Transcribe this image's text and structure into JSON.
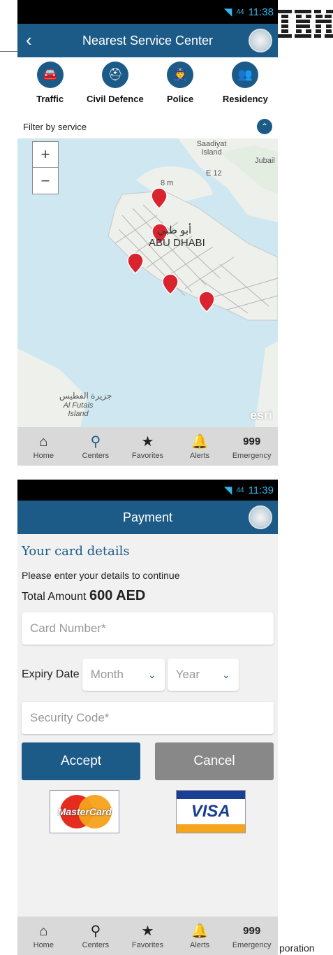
{
  "screen1": {
    "status": {
      "signal_small": "44",
      "time": "11:38"
    },
    "appbar_title": "Nearest Service Center",
    "services": [
      {
        "label": "Traffic",
        "icon": "car-icon"
      },
      {
        "label": "Civil Defence",
        "icon": "firefighter-icon"
      },
      {
        "label": "Police",
        "icon": "police-officer-icon"
      },
      {
        "label": "Residency",
        "icon": "residency-icon"
      }
    ],
    "filter_label": "Filter by service",
    "map": {
      "zoom_in": "+",
      "zoom_out": "−",
      "labels": {
        "saadiyat": "Saadiyat Island",
        "jubail": "Jubail",
        "e12": "E 12",
        "distance": "8 m",
        "city_ar": "أبو ظبي",
        "city_en": "ABU DHABI",
        "futais_ar": "جزيرة الفطيس",
        "futais_en": "Al Futais Island"
      },
      "attribution": "esri"
    }
  },
  "screen2": {
    "status": {
      "signal_small": "44",
      "time": "11:39"
    },
    "appbar_title": "Payment",
    "heading": "Your card details",
    "instructions": "Please enter your details to continue",
    "total_label": "Total Amount",
    "total_value": "600 AED",
    "card_number_placeholder": "Card Number*",
    "expiry_label": "Expiry Date",
    "month_placeholder": "Month",
    "year_placeholder": "Year",
    "security_placeholder": "Security Code*",
    "accept_label": "Accept",
    "cancel_label": "Cancel",
    "mastercard_text": "MasterCard",
    "visa_text": "VISA"
  },
  "nav": [
    {
      "label": "Home",
      "icon": "home-icon"
    },
    {
      "label": "Centers",
      "icon": "location-pin-icon"
    },
    {
      "label": "Favorites",
      "icon": "star-icon"
    },
    {
      "label": "Alerts",
      "icon": "bell-icon"
    },
    {
      "label": "Emergency",
      "icon_text": "999"
    }
  ],
  "overlay": {
    "corner_text": "poration"
  },
  "colors": {
    "primary": "#1c5b87",
    "status_text": "#35b6e8",
    "nav_bg": "#d9d9d9",
    "cancel": "#888888",
    "pin": "#d9242f"
  }
}
